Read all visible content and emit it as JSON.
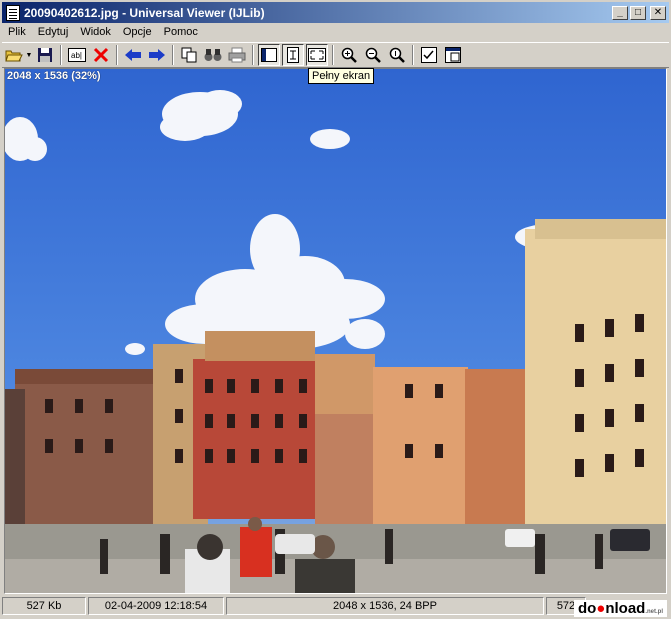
{
  "window": {
    "title": "20090402612.jpg - Universal Viewer (IJLib)",
    "min_label": "_",
    "max_label": "□",
    "close_label": "✕"
  },
  "menu": {
    "items": [
      "Plik",
      "Edytuj",
      "Widok",
      "Opcje",
      "Pomoc"
    ]
  },
  "toolbar": {
    "buttons": [
      {
        "name": "open",
        "icon": "folder-open-icon"
      },
      {
        "name": "save",
        "icon": "floppy-disk-icon"
      },
      {
        "name": "rename",
        "icon": "rename-icon"
      },
      {
        "name": "delete",
        "icon": "red-x-icon"
      },
      {
        "name": "previous",
        "icon": "arrow-left-icon"
      },
      {
        "name": "next",
        "icon": "arrow-right-icon"
      },
      {
        "name": "copy",
        "icon": "copy-icon"
      },
      {
        "name": "find",
        "icon": "binoculars-icon"
      },
      {
        "name": "print",
        "icon": "printer-icon"
      },
      {
        "name": "panel",
        "icon": "panel-icon"
      },
      {
        "name": "fit",
        "icon": "fit-window-icon"
      },
      {
        "name": "fullscreen",
        "icon": "fullscreen-icon"
      },
      {
        "name": "zoom-in",
        "icon": "zoom-in-icon"
      },
      {
        "name": "zoom-out",
        "icon": "zoom-out-icon"
      },
      {
        "name": "zoom-actual",
        "icon": "zoom-actual-icon"
      },
      {
        "name": "options",
        "icon": "checklist-icon"
      },
      {
        "name": "window",
        "icon": "window-icon"
      }
    ],
    "tooltip": "Pełny ekran"
  },
  "viewer": {
    "dims_label": "2048 x 1536 (32%)"
  },
  "status": {
    "size": "527 Kb",
    "date": "02-04-2009 12:18:54",
    "info": "2048 x 1536, 24 BPP",
    "extra": "572"
  },
  "watermark": {
    "text_a": "do",
    "text_b": "nload",
    "sub": ".net.pl"
  }
}
